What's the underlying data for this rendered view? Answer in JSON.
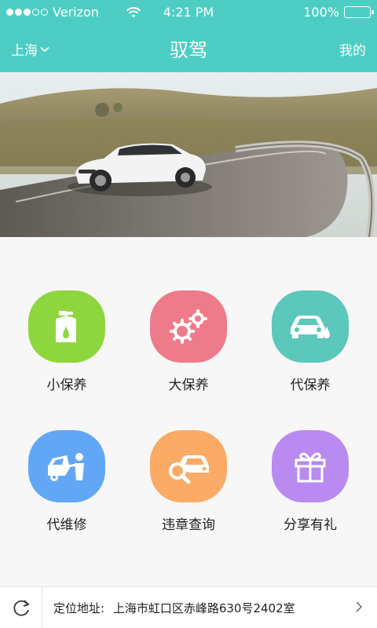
{
  "status_bar": {
    "carrier": "Verizon",
    "signal_bars_filled": 3,
    "signal_bars_total": 5,
    "time": "4:21 PM",
    "battery": "100%"
  },
  "nav": {
    "city": "上海",
    "title": "驭驾",
    "mine": "我的",
    "color": "#4ecdc4"
  },
  "banner": {
    "image": "white sports car driving on curved highway"
  },
  "services": [
    {
      "label": "小保养",
      "icon": "oil-can-icon",
      "color": "#8ed63e"
    },
    {
      "label": "大保养",
      "icon": "gears-icon",
      "color": "#ee7b8a"
    },
    {
      "label": "代保养",
      "icon": "car-oil-drop-icon",
      "color": "#5cc7bb"
    },
    {
      "label": "代维修",
      "icon": "car-repair-icon",
      "color": "#62a7f5"
    },
    {
      "label": "违章查询",
      "icon": "car-search-icon",
      "color": "#fbab66"
    },
    {
      "label": "分享有礼",
      "icon": "gift-icon",
      "color": "#b98af0"
    }
  ],
  "location": {
    "prefix": "定位地址:",
    "address": "上海市虹口区赤峰路630号2402室"
  }
}
